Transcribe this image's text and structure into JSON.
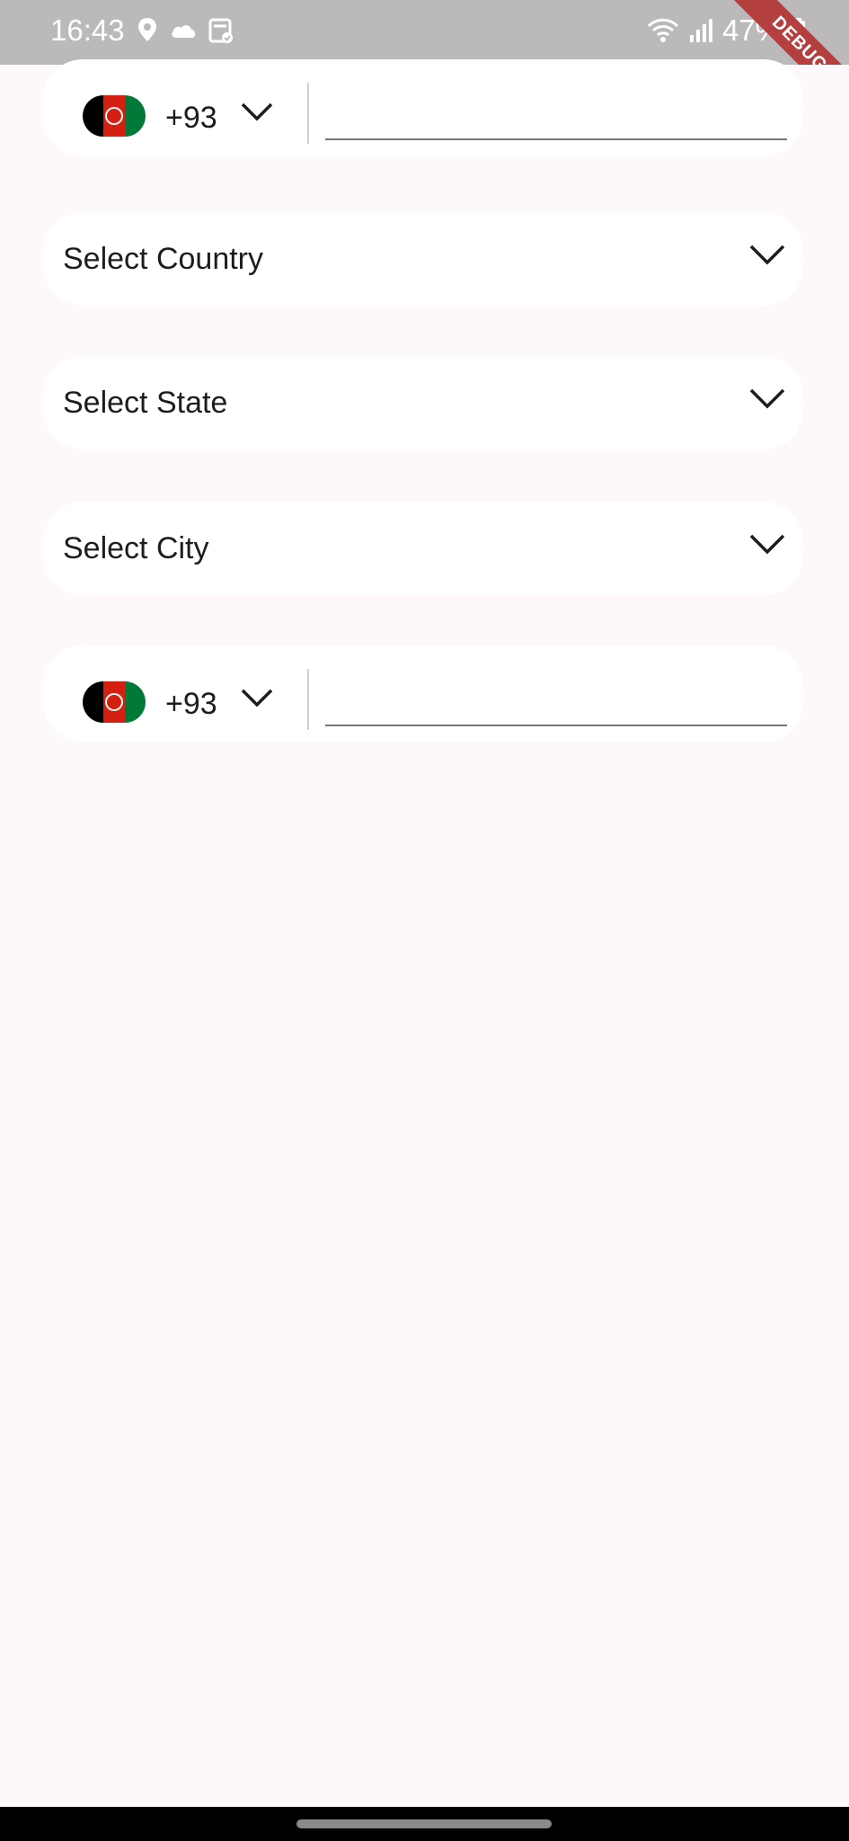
{
  "status_bar": {
    "time": "16:43",
    "battery": "47%",
    "debug_label": "DEBUG",
    "icons": [
      "location-pin-icon",
      "cloud-icon",
      "calendar-check-icon",
      "wifi-icon",
      "signal-icon",
      "battery-icon"
    ]
  },
  "phone_field_top": {
    "flag": "afghanistan-flag",
    "dial_code": "+93",
    "value": "",
    "placeholder": ""
  },
  "country_select": {
    "label": "Select Country"
  },
  "state_select": {
    "label": "Select State"
  },
  "city_select": {
    "label": "Select City"
  },
  "phone_field_bottom": {
    "flag": "afghanistan-flag",
    "dial_code": "+93",
    "value": "",
    "placeholder": ""
  },
  "colors": {
    "background": "#fdf8fc",
    "card": "#ffffff",
    "status_bar": "#bcb9ba",
    "debug_banner": "#b43f3f",
    "flag_black": "#000000",
    "flag_red": "#d32011",
    "flag_green": "#007a36"
  }
}
